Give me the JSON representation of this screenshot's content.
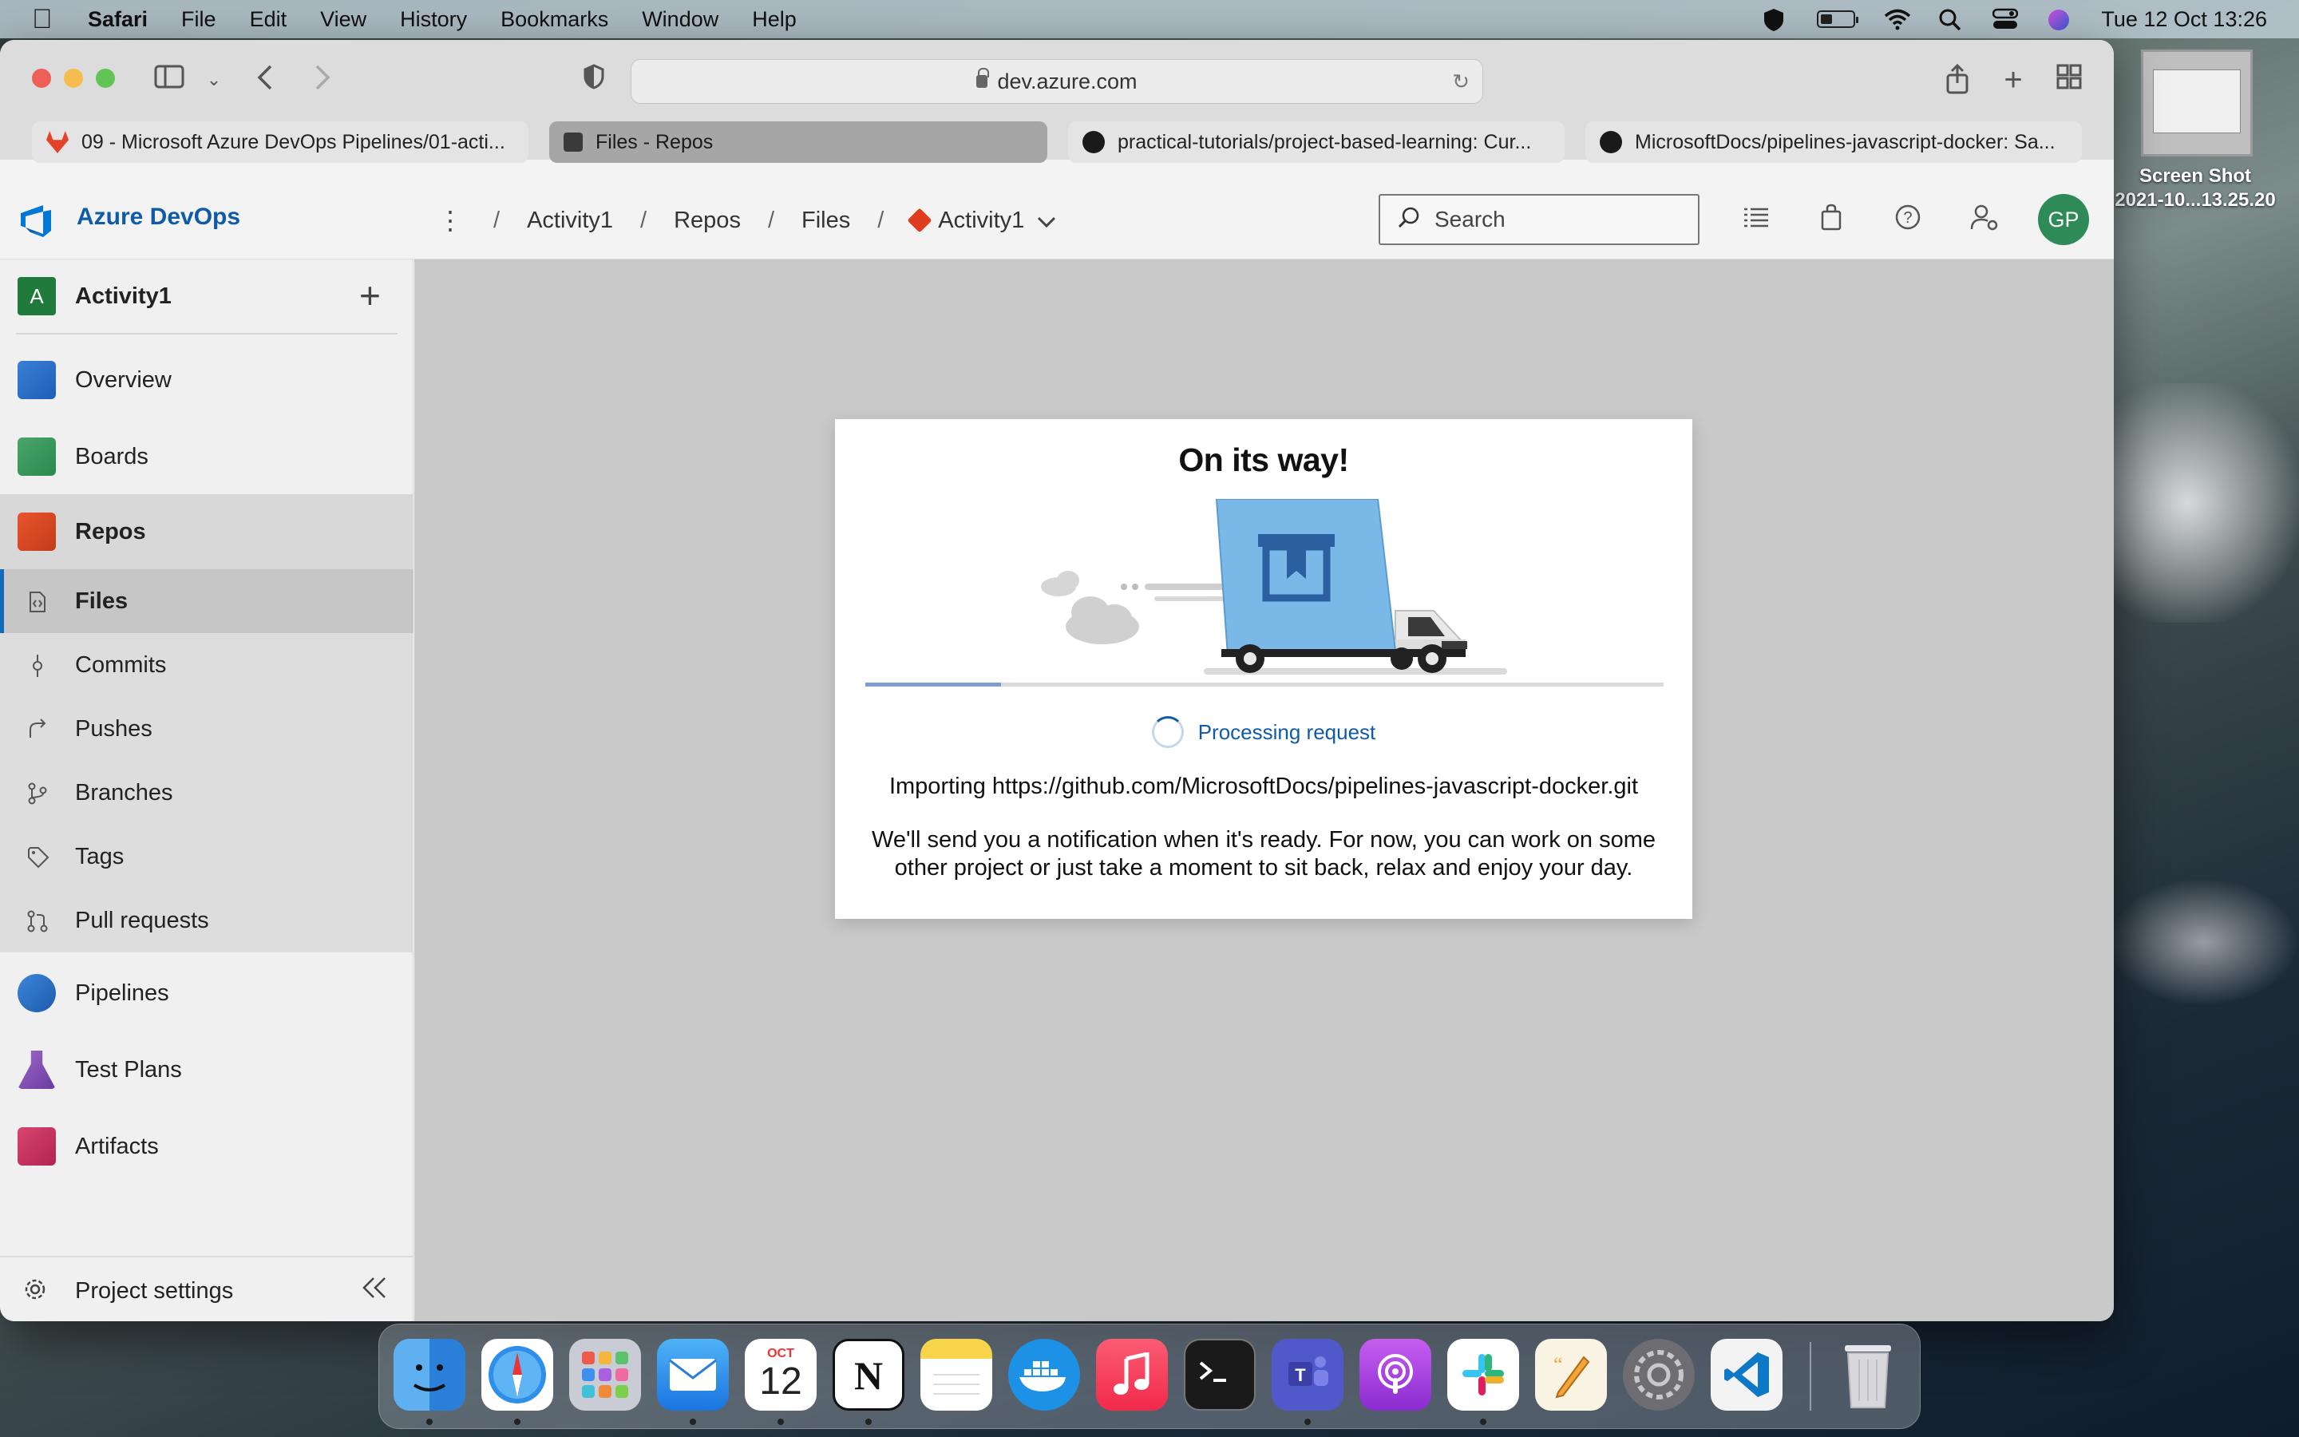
{
  "menubar": {
    "app_name": "Safari",
    "items": [
      "File",
      "Edit",
      "View",
      "History",
      "Bookmarks",
      "Window",
      "Help"
    ],
    "datetime": "Tue 12 Oct  13:26",
    "status_icons": [
      "shield-icon",
      "battery-icon",
      "wifi-icon",
      "spotlight-icon",
      "control-center-icon",
      "siri-icon"
    ]
  },
  "browser": {
    "url": "dev.azure.com",
    "tabs": [
      {
        "label": "09 - Microsoft Azure DevOps Pipelines/01-acti...",
        "icon": "gitlab-icon",
        "active": false
      },
      {
        "label": "Files - Repos",
        "icon": "azure-devops-icon",
        "active": true
      },
      {
        "label": "practical-tutorials/project-based-learning: Cur...",
        "icon": "github-icon",
        "active": false
      },
      {
        "label": "MicrosoftDocs/pipelines-javascript-docker: Sa...",
        "icon": "github-icon",
        "active": false
      }
    ]
  },
  "ado": {
    "brand": "Azure DevOps",
    "breadcrumb": [
      "Activity1",
      "Repos",
      "Files",
      "Activity1"
    ],
    "search_placeholder": "Search",
    "avatar_initials": "GP"
  },
  "sidebar": {
    "project_initial": "A",
    "project_name": "Activity1",
    "items": [
      {
        "label": "Overview"
      },
      {
        "label": "Boards"
      },
      {
        "label": "Repos"
      },
      {
        "label": "Pipelines"
      },
      {
        "label": "Test Plans"
      },
      {
        "label": "Artifacts"
      }
    ],
    "repos_sub": [
      {
        "label": "Files",
        "active": true
      },
      {
        "label": "Commits"
      },
      {
        "label": "Pushes"
      },
      {
        "label": "Branches"
      },
      {
        "label": "Tags"
      },
      {
        "label": "Pull requests"
      }
    ],
    "settings_label": "Project settings"
  },
  "modal": {
    "title": "On its way!",
    "progress_fraction": 0.17,
    "status": "Processing request",
    "importing": "Importing https://github.com/MicrosoftDocs/pipelines-javascript-docker.git",
    "notice": "We'll send you a notification when it's ready. For now, you can work on some other project or just take a moment to sit back, relax and enjoy your day."
  },
  "desktop": {
    "screenshot_label_line1": "Screen Shot",
    "screenshot_label_line2": "2021-10...13.25.20"
  },
  "dock": {
    "calendar_month": "OCT",
    "calendar_day": "12",
    "apps": [
      "finder-icon",
      "safari-icon",
      "launchpad-icon",
      "mail-icon",
      "calendar-icon",
      "notion-icon",
      "notes-icon",
      "docker-icon",
      "music-icon",
      "terminal-icon",
      "teams-icon",
      "podcasts-icon",
      "slack-icon",
      "pages-icon",
      "system-preferences-icon",
      "vscode-icon",
      "trash-icon"
    ]
  }
}
